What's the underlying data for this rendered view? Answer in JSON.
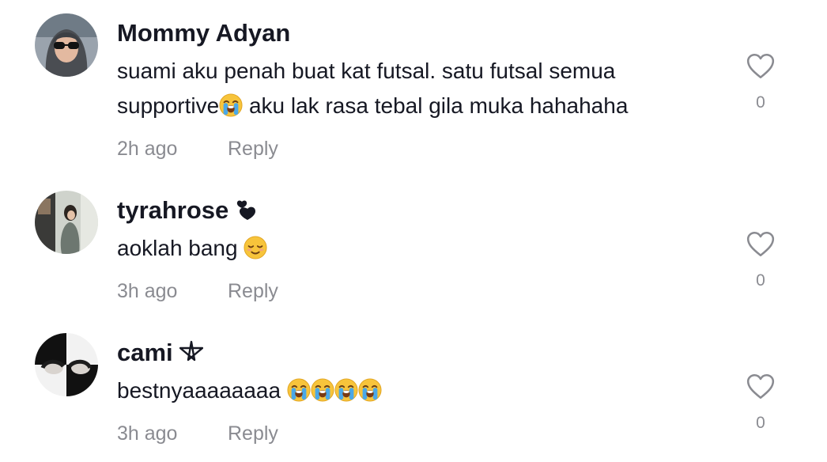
{
  "comments": [
    {
      "username": "Mommy Adyan",
      "text_line1": "suami aku penah buat kat futsal. satu futsal semua",
      "text_line2a": "supportive",
      "text_line2b": " aku lak rasa tebal gila muka hahahaha",
      "time": "2h ago",
      "reply_label": "Reply",
      "likes": "0"
    },
    {
      "username": "tyrahrose",
      "text": "aoklah bang ",
      "time": "3h ago",
      "reply_label": "Reply",
      "likes": "0"
    },
    {
      "username": "cami",
      "text": "bestnyaaaaaaaa ",
      "time": "3h ago",
      "reply_label": "Reply",
      "likes": "0"
    }
  ],
  "icons": {
    "like": "heart-outline-icon",
    "crying_emoji": "loudly-crying-face-emoji",
    "relieved_emoji": "relieved-face-emoji",
    "badge_heart": "heart-exclamation-icon",
    "badge_pentagram": "pentagram-icon"
  },
  "colors": {
    "text_primary": "#161823",
    "text_secondary": "#8a8b91",
    "emoji_yellow": "#f7c43b"
  }
}
